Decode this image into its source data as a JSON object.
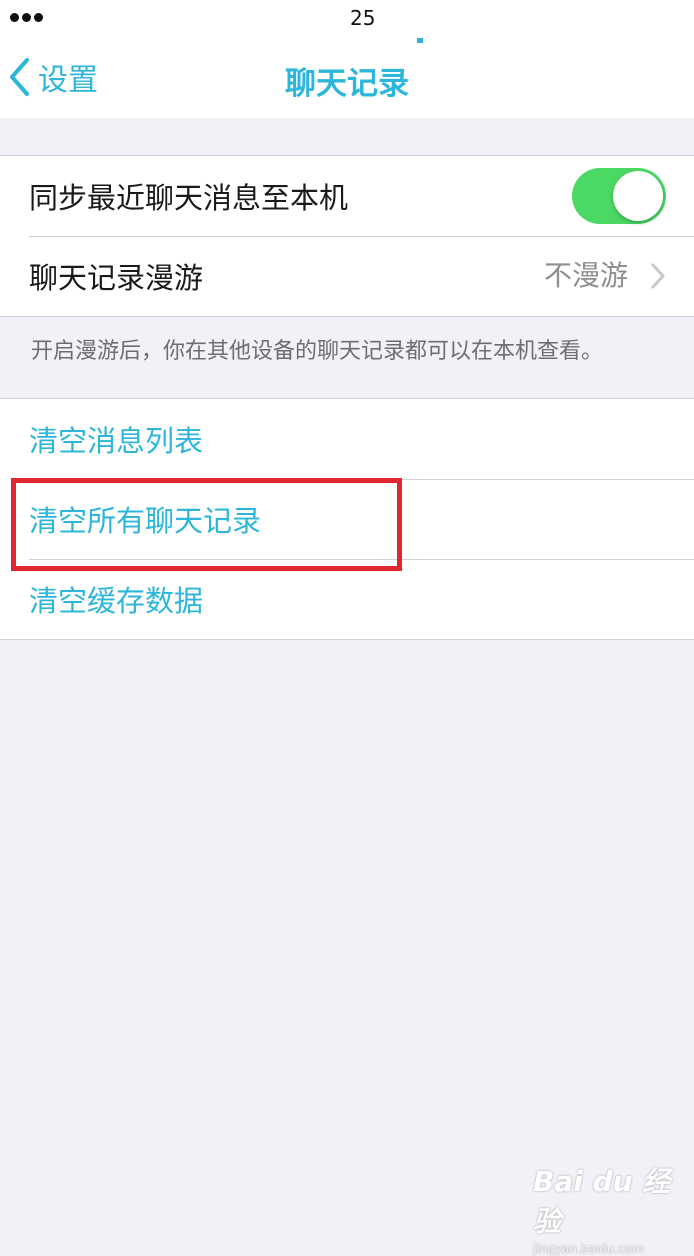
{
  "status_bar": {
    "time": "25"
  },
  "nav": {
    "back_label": "设置",
    "title": "聊天记录"
  },
  "settings": {
    "sync_label": "同步最近聊天消息至本机",
    "sync_enabled": true,
    "roaming_label": "聊天记录漫游",
    "roaming_value": "不漫游",
    "footnote": "开启漫游后，你在其他设备的聊天记录都可以在本机查看。"
  },
  "actions": {
    "clear_message_list": "清空消息列表",
    "clear_all_chat_history": "清空所有聊天记录",
    "clear_cache": "清空缓存数据"
  },
  "watermark": {
    "logo": "Bai du 经验",
    "url": "jingyan.baidu.com"
  },
  "colors": {
    "accent": "#2cb6d9",
    "toggle_on": "#4cd864",
    "highlight": "#e0262f",
    "background": "#f2f1f7"
  }
}
